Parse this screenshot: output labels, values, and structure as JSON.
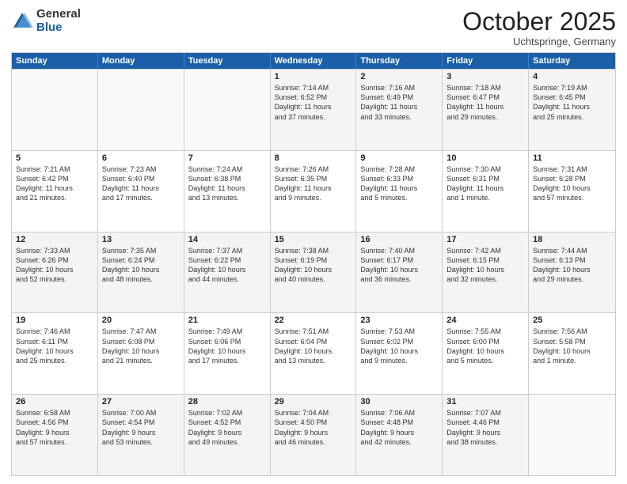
{
  "logo": {
    "general": "General",
    "blue": "Blue"
  },
  "header": {
    "month": "October 2025",
    "location": "Uchtspringe, Germany"
  },
  "days": [
    "Sunday",
    "Monday",
    "Tuesday",
    "Wednesday",
    "Thursday",
    "Friday",
    "Saturday"
  ],
  "weeks": [
    [
      {
        "day": "",
        "info": ""
      },
      {
        "day": "",
        "info": ""
      },
      {
        "day": "",
        "info": ""
      },
      {
        "day": "1",
        "info": "Sunrise: 7:14 AM\nSunset: 6:52 PM\nDaylight: 11 hours\nand 37 minutes."
      },
      {
        "day": "2",
        "info": "Sunrise: 7:16 AM\nSunset: 6:49 PM\nDaylight: 11 hours\nand 33 minutes."
      },
      {
        "day": "3",
        "info": "Sunrise: 7:18 AM\nSunset: 6:47 PM\nDaylight: 11 hours\nand 29 minutes."
      },
      {
        "day": "4",
        "info": "Sunrise: 7:19 AM\nSunset: 6:45 PM\nDaylight: 11 hours\nand 25 minutes."
      }
    ],
    [
      {
        "day": "5",
        "info": "Sunrise: 7:21 AM\nSunset: 6:42 PM\nDaylight: 11 hours\nand 21 minutes."
      },
      {
        "day": "6",
        "info": "Sunrise: 7:23 AM\nSunset: 6:40 PM\nDaylight: 11 hours\nand 17 minutes."
      },
      {
        "day": "7",
        "info": "Sunrise: 7:24 AM\nSunset: 6:38 PM\nDaylight: 11 hours\nand 13 minutes."
      },
      {
        "day": "8",
        "info": "Sunrise: 7:26 AM\nSunset: 6:35 PM\nDaylight: 11 hours\nand 9 minutes."
      },
      {
        "day": "9",
        "info": "Sunrise: 7:28 AM\nSunset: 6:33 PM\nDaylight: 11 hours\nand 5 minutes."
      },
      {
        "day": "10",
        "info": "Sunrise: 7:30 AM\nSunset: 6:31 PM\nDaylight: 11 hours\nand 1 minute."
      },
      {
        "day": "11",
        "info": "Sunrise: 7:31 AM\nSunset: 6:28 PM\nDaylight: 10 hours\nand 57 minutes."
      }
    ],
    [
      {
        "day": "12",
        "info": "Sunrise: 7:33 AM\nSunset: 6:26 PM\nDaylight: 10 hours\nand 52 minutes."
      },
      {
        "day": "13",
        "info": "Sunrise: 7:35 AM\nSunset: 6:24 PM\nDaylight: 10 hours\nand 48 minutes."
      },
      {
        "day": "14",
        "info": "Sunrise: 7:37 AM\nSunset: 6:22 PM\nDaylight: 10 hours\nand 44 minutes."
      },
      {
        "day": "15",
        "info": "Sunrise: 7:38 AM\nSunset: 6:19 PM\nDaylight: 10 hours\nand 40 minutes."
      },
      {
        "day": "16",
        "info": "Sunrise: 7:40 AM\nSunset: 6:17 PM\nDaylight: 10 hours\nand 36 minutes."
      },
      {
        "day": "17",
        "info": "Sunrise: 7:42 AM\nSunset: 6:15 PM\nDaylight: 10 hours\nand 32 minutes."
      },
      {
        "day": "18",
        "info": "Sunrise: 7:44 AM\nSunset: 6:13 PM\nDaylight: 10 hours\nand 29 minutes."
      }
    ],
    [
      {
        "day": "19",
        "info": "Sunrise: 7:46 AM\nSunset: 6:11 PM\nDaylight: 10 hours\nand 25 minutes."
      },
      {
        "day": "20",
        "info": "Sunrise: 7:47 AM\nSunset: 6:08 PM\nDaylight: 10 hours\nand 21 minutes."
      },
      {
        "day": "21",
        "info": "Sunrise: 7:49 AM\nSunset: 6:06 PM\nDaylight: 10 hours\nand 17 minutes."
      },
      {
        "day": "22",
        "info": "Sunrise: 7:51 AM\nSunset: 6:04 PM\nDaylight: 10 hours\nand 13 minutes."
      },
      {
        "day": "23",
        "info": "Sunrise: 7:53 AM\nSunset: 6:02 PM\nDaylight: 10 hours\nand 9 minutes."
      },
      {
        "day": "24",
        "info": "Sunrise: 7:55 AM\nSunset: 6:00 PM\nDaylight: 10 hours\nand 5 minutes."
      },
      {
        "day": "25",
        "info": "Sunrise: 7:56 AM\nSunset: 5:58 PM\nDaylight: 10 hours\nand 1 minute."
      }
    ],
    [
      {
        "day": "26",
        "info": "Sunrise: 6:58 AM\nSunset: 4:56 PM\nDaylight: 9 hours\nand 57 minutes."
      },
      {
        "day": "27",
        "info": "Sunrise: 7:00 AM\nSunset: 4:54 PM\nDaylight: 9 hours\nand 53 minutes."
      },
      {
        "day": "28",
        "info": "Sunrise: 7:02 AM\nSunset: 4:52 PM\nDaylight: 9 hours\nand 49 minutes."
      },
      {
        "day": "29",
        "info": "Sunrise: 7:04 AM\nSunset: 4:50 PM\nDaylight: 9 hours\nand 46 minutes."
      },
      {
        "day": "30",
        "info": "Sunrise: 7:06 AM\nSunset: 4:48 PM\nDaylight: 9 hours\nand 42 minutes."
      },
      {
        "day": "31",
        "info": "Sunrise: 7:07 AM\nSunset: 4:46 PM\nDaylight: 9 hours\nand 38 minutes."
      },
      {
        "day": "",
        "info": ""
      }
    ]
  ]
}
